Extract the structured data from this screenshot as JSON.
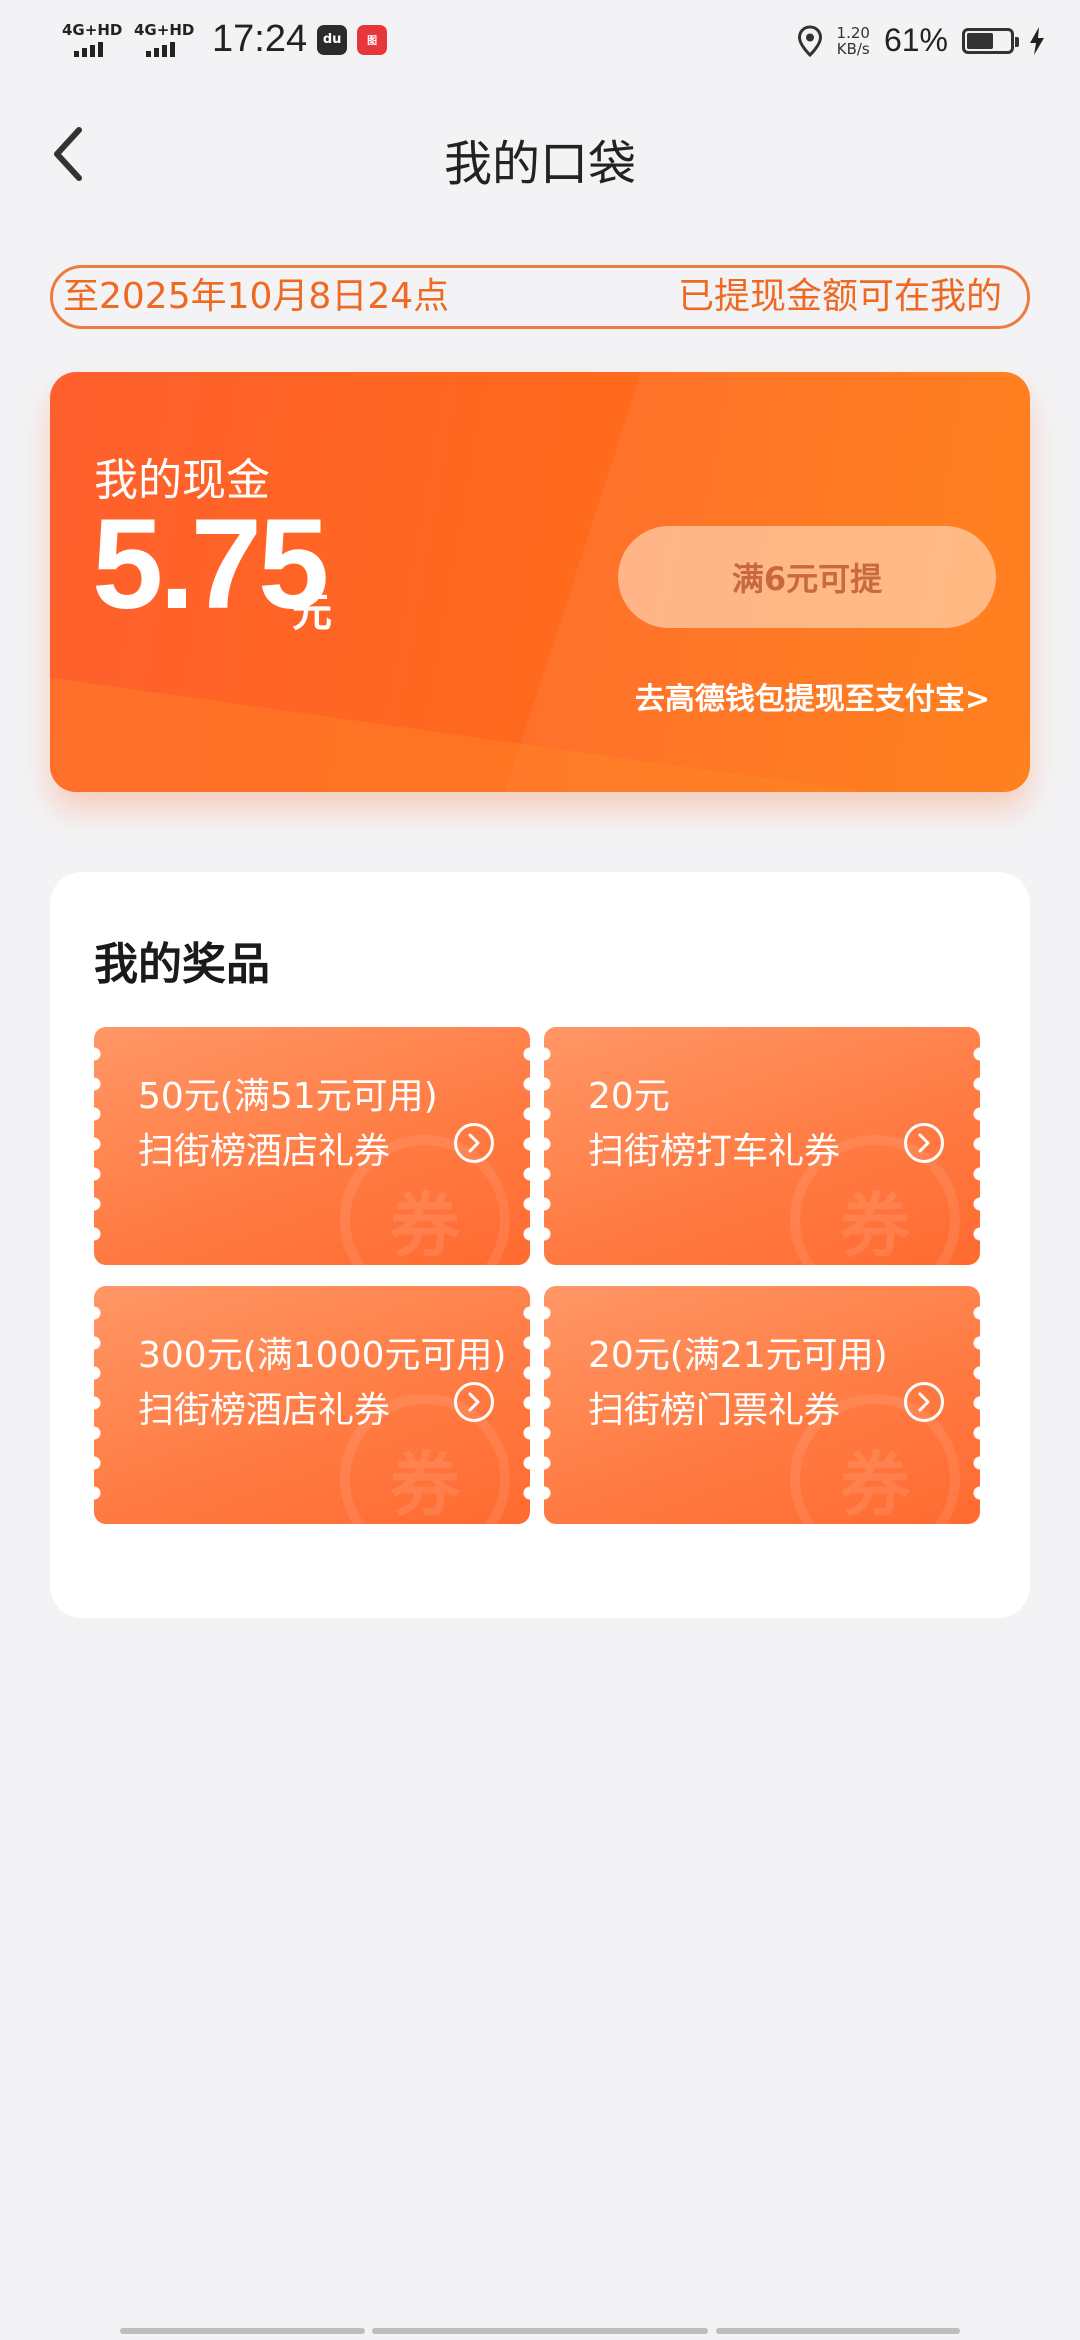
{
  "status_bar": {
    "network1": "4G+HD",
    "network2": "4G+HD",
    "time": "17:24",
    "app_icon1": "du",
    "app_icon2": "图",
    "speed_value": "1.20",
    "speed_unit": "KB/s",
    "battery_percent": "61%",
    "battery_level": 0.61
  },
  "header": {
    "title": "我的口袋"
  },
  "notice": {
    "text_left": "至2025年10月8日24点",
    "text_right": "已提现金额可在我的"
  },
  "cash": {
    "label": "我的现金",
    "amount": "5.75",
    "unit": "元",
    "withdraw_button": "满6元可提",
    "wallet_link": "去高德钱包提现至支付宝>"
  },
  "prizes": {
    "title": "我的奖品",
    "coupons": [
      {
        "value": "50元(满51元可用)",
        "name": "扫街榜酒店礼券"
      },
      {
        "value": "20元",
        "name": "扫街榜打车礼券"
      },
      {
        "value": "300元(满1000元可用)",
        "name": "扫街榜酒店礼券"
      },
      {
        "value": "20元(满21元可用)",
        "name": "扫街榜门票礼券"
      }
    ],
    "watermark": "券"
  },
  "colors": {
    "accent": "#ff6a1c",
    "notice_text": "#ee6a22",
    "coupon": "#ff7c44"
  }
}
